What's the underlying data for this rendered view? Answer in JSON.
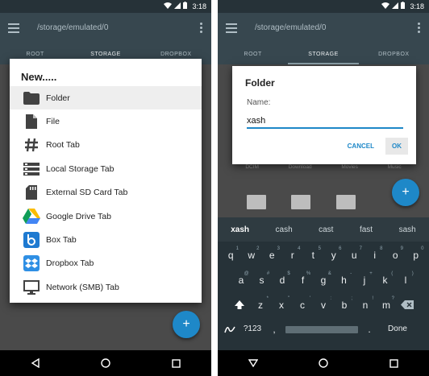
{
  "status": {
    "time": "3:18"
  },
  "appbar": {
    "path": "/storage/emulated/0"
  },
  "tabs": [
    "ROOT",
    "STORAGE",
    "DROPBOX"
  ],
  "new_dialog": {
    "title": "New.....",
    "items": [
      {
        "label": "Folder",
        "icon": "folder-icon"
      },
      {
        "label": "File",
        "icon": "file-icon"
      },
      {
        "label": "Root Tab",
        "icon": "hash-icon"
      },
      {
        "label": "Local Storage Tab",
        "icon": "storage-icon"
      },
      {
        "label": "External SD Card Tab",
        "icon": "sd-card-icon"
      },
      {
        "label": "Google Drive Tab",
        "icon": "google-drive-icon"
      },
      {
        "label": "Box Tab",
        "icon": "box-icon"
      },
      {
        "label": "Dropbox Tab",
        "icon": "dropbox-icon"
      },
      {
        "label": "Network (SMB) Tab",
        "icon": "monitor-icon"
      }
    ]
  },
  "folder_dialog": {
    "title": "Folder",
    "name_label": "Name:",
    "name_value": "xash",
    "cancel_label": "CANCEL",
    "ok_label": "OK"
  },
  "background_labels": [
    "DCIM",
    "Download",
    "Movies",
    "Music"
  ],
  "fab_label": "+",
  "keyboard": {
    "suggestions": [
      "xash",
      "cash",
      "cast",
      "fast",
      "sash"
    ],
    "row1": [
      {
        "k": "q",
        "n": "1"
      },
      {
        "k": "w",
        "n": "2"
      },
      {
        "k": "e",
        "n": "3"
      },
      {
        "k": "r",
        "n": "4"
      },
      {
        "k": "t",
        "n": "5"
      },
      {
        "k": "y",
        "n": "6"
      },
      {
        "k": "u",
        "n": "7"
      },
      {
        "k": "i",
        "n": "8"
      },
      {
        "k": "o",
        "n": "9"
      },
      {
        "k": "p",
        "n": "0"
      }
    ],
    "row2": [
      {
        "k": "a",
        "n": "@"
      },
      {
        "k": "s",
        "n": "#"
      },
      {
        "k": "d",
        "n": "$"
      },
      {
        "k": "f",
        "n": "%"
      },
      {
        "k": "g",
        "n": "&"
      },
      {
        "k": "h",
        "n": "-"
      },
      {
        "k": "j",
        "n": "+"
      },
      {
        "k": "k",
        "n": "("
      },
      {
        "k": "l",
        "n": ")"
      }
    ],
    "row3": [
      {
        "k": "z",
        "n": "*"
      },
      {
        "k": "x",
        "n": "\""
      },
      {
        "k": "c",
        "n": "'"
      },
      {
        "k": "v",
        "n": ":"
      },
      {
        "k": "b",
        "n": ";"
      },
      {
        "k": "n",
        "n": "!"
      },
      {
        "k": "m",
        "n": "?"
      }
    ],
    "symbols_label": "?123",
    "comma": ",",
    "period": ".",
    "done_label": "Done"
  }
}
